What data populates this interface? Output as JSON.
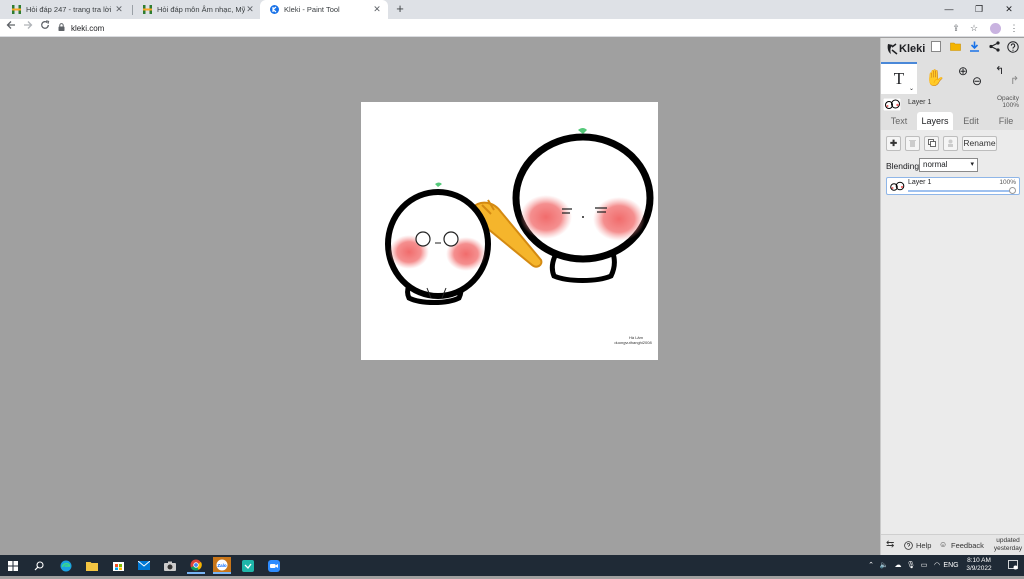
{
  "browser": {
    "tabs": [
      {
        "title": "Hỏi đáp 247 - trang tra lời",
        "close": "✕"
      },
      {
        "title": "Hỏi đáp môn Âm nhạc, Mỹ thuật",
        "close": "✕"
      },
      {
        "title": "Kleki - Paint Tool",
        "close": "✕"
      }
    ],
    "new_tab": "+",
    "window_controls": {
      "minimize": "—",
      "restore": "❐",
      "close": "✕"
    },
    "url": "kleki.com"
  },
  "kleki": {
    "logo": "Kleki",
    "layer_info": {
      "name": "Layer 1",
      "opacity_label": "Opacity",
      "opacity_value": "100%"
    },
    "tabs": [
      "Text",
      "Layers",
      "Edit",
      "File"
    ],
    "layers_panel": {
      "rename_label": "Rename",
      "blending_label": "Blending",
      "blending_value": "normal",
      "layers": [
        {
          "name": "Layer 1",
          "opacity": "100%"
        }
      ]
    },
    "bottom": {
      "help_label": "Help",
      "feedback_label": "Feedback",
      "updated_line1": "updated",
      "updated_line2": "yesterday"
    },
    "canvas_signature": {
      "line1": "Hà Lâm",
      "line2": "duongvuthanghi2008"
    }
  },
  "taskbar": {
    "language": "ENG",
    "time": "8:10 AM",
    "date": "3/9/2022"
  },
  "colors": {
    "accent": "#4a88d8",
    "panel": "#e0e0e0",
    "workspace": "#a0a0a0",
    "taskbar": "#1f2a36"
  }
}
